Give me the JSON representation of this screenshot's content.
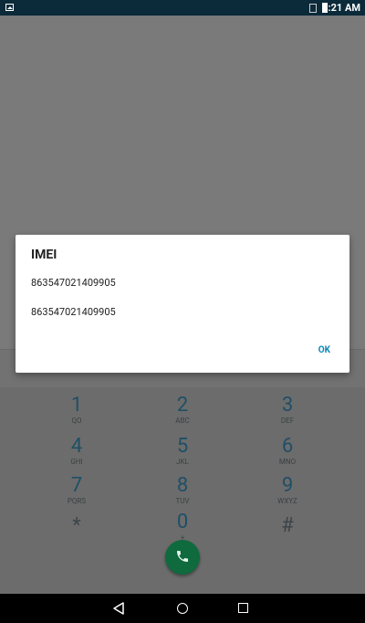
{
  "status_bar": {
    "time": "3:21 AM"
  },
  "dialog": {
    "title": "IMEI",
    "imei_1": "863547021409905",
    "imei_2": "863547021409905",
    "ok_label": "OK"
  },
  "keypad": {
    "keys": [
      {
        "digit": "1",
        "letters": "QO"
      },
      {
        "digit": "2",
        "letters": "ABC"
      },
      {
        "digit": "3",
        "letters": "DEF"
      },
      {
        "digit": "4",
        "letters": "GHI"
      },
      {
        "digit": "5",
        "letters": "JKL"
      },
      {
        "digit": "6",
        "letters": "MNO"
      },
      {
        "digit": "7",
        "letters": "PQRS"
      },
      {
        "digit": "8",
        "letters": "TUV"
      },
      {
        "digit": "9",
        "letters": "WXYZ"
      },
      {
        "digit": "*",
        "letters": ""
      },
      {
        "digit": "0",
        "letters": "+"
      },
      {
        "digit": "#",
        "letters": ""
      }
    ]
  },
  "colors": {
    "status_bar": "#0b2a3a",
    "accent": "#0a86b8",
    "call_button": "#0f6a3d",
    "keypad_digit": "#1f4f66"
  },
  "icons": {
    "status_left": "image-icon",
    "status_sim": "no-sim-icon",
    "status_battery": "battery-icon",
    "call": "phone-icon",
    "nav_back": "back-icon",
    "nav_home": "home-icon",
    "nav_recent": "recent-apps-icon"
  }
}
